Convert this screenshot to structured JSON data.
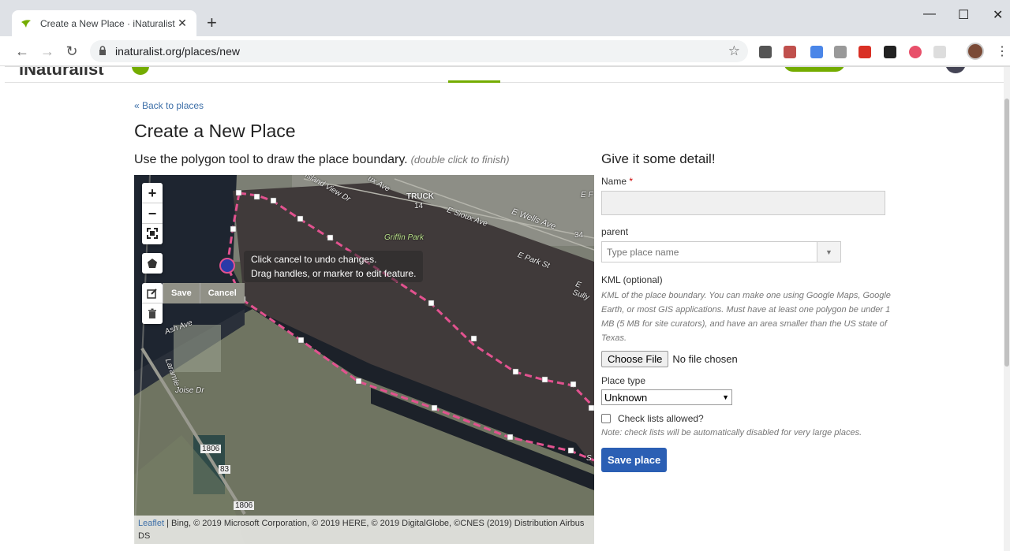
{
  "browser": {
    "tab_title": "Create a New Place · iNaturalist",
    "url": "inaturalist.org/places/new"
  },
  "site": {
    "logo": "iNaturalist"
  },
  "page": {
    "back_link": "« Back to places",
    "title": "Create a New Place",
    "instructions": "Use the polygon tool to draw the place boundary.",
    "instructions_hint": "(double click to finish)"
  },
  "map": {
    "zoom_in": "+",
    "zoom_out": "−",
    "save_label": "Save",
    "cancel_label": "Cancel",
    "tooltip_line1": "Click cancel to undo changes.",
    "tooltip_line2": "Drag handles, or marker to edit feature.",
    "attribution_link": "Leaflet",
    "attribution_text": " | Bing, © 2019 Microsoft Corporation, © 2019 HERE, © 2019 DigitalGlobe, ©CNES (2019) Distribution Airbus DS",
    "labels": {
      "island_view": "Island View Dr",
      "aux_ave": "ux Ave",
      "truck": "TRUCK",
      "route14": "14",
      "sioux": "E Sioux Ave",
      "wells": "E Wells Ave",
      "griffin": "Griffin Park",
      "route34": "34",
      "park_st": "E Park St",
      "sully": "E Sully",
      "ash": "Ash Ave",
      "laramie": "Laramie",
      "joise": "Joise Dr",
      "route1806a": "1806",
      "route83": "83",
      "route1806b": "1806",
      "ef": "E F",
      "s": "S"
    },
    "polygon_color": "#e2528f",
    "water_color": "#1b2028"
  },
  "form": {
    "heading": "Give it some detail!",
    "name_label": "Name",
    "name_required": "*",
    "name_value": "",
    "parent_label": "parent",
    "parent_placeholder": "Type place name",
    "kml_label": "KML (optional)",
    "kml_help": "KML of the place boundary. You can make one using Google Maps, Google Earth, or most GIS applications. Must have at least one polygon be under 1 MB (5 MB for site curators), and have an area smaller than the US state of Texas.",
    "choose_file": "Choose File",
    "no_file": "No file chosen",
    "place_type_label": "Place type",
    "place_type_value": "Unknown",
    "check_lists_label": "Check lists allowed?",
    "check_lists_note": "Note: check lists will be automatically disabled for very large places.",
    "save_button": "Save place"
  },
  "colors": {
    "accent_green": "#74ac00",
    "link_blue": "#3d6fa8",
    "button_blue": "#2b5fb4"
  }
}
